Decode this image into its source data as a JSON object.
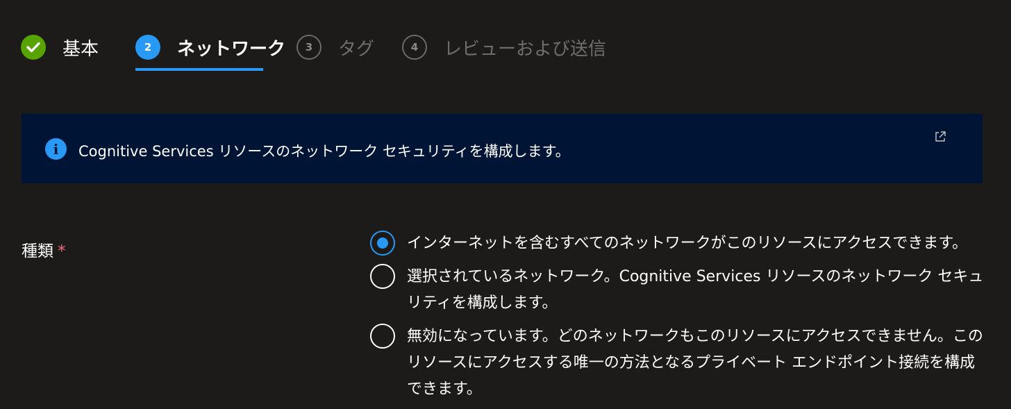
{
  "steps": [
    {
      "number": "",
      "label": "基本",
      "state": "complete"
    },
    {
      "number": "2",
      "label": "ネットワーク",
      "state": "current"
    },
    {
      "number": "3",
      "label": "タグ",
      "state": "todo"
    },
    {
      "number": "4",
      "label": "レビューおよび送信",
      "state": "todo"
    }
  ],
  "banner": {
    "icon": "info-icon",
    "text": "Cognitive Services リソースのネットワーク セキュリティを構成します。",
    "link_icon": "external-link-icon"
  },
  "form": {
    "type_label": "種類",
    "required_mark": "*",
    "options": [
      {
        "label": "インターネットを含むすべてのネットワークがこのリソースにアクセスできます。",
        "selected": true
      },
      {
        "label": "選択されているネットワーク。Cognitive Services リソースのネットワーク セキュリティを構成します。",
        "selected": false
      },
      {
        "label": "無効になっています。どのネットワークもこのリソースにアクセスできません。このリソースにアクセスする唯一の方法となるプライベート エンドポイント接続を構成できます。",
        "selected": false
      }
    ]
  },
  "colors": {
    "background": "#1c1b1a",
    "accent": "#2899f5",
    "complete": "#57a300",
    "banner": "#001536",
    "required": "#f1707b"
  }
}
